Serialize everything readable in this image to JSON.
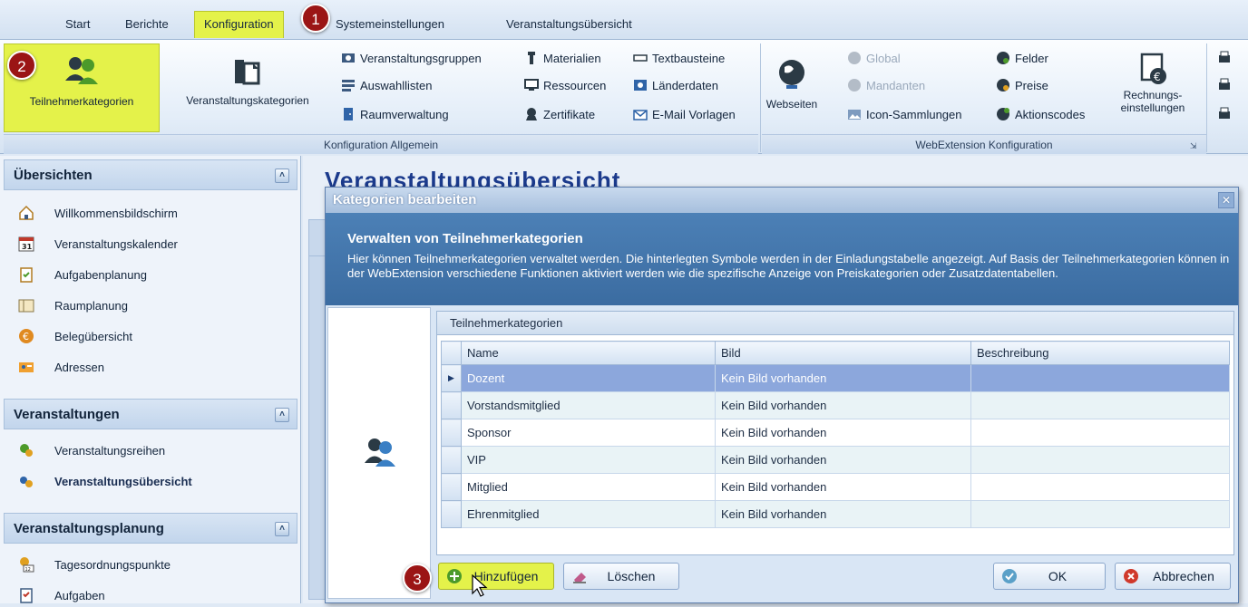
{
  "tabs": [
    {
      "label": "Start"
    },
    {
      "label": "Berichte"
    },
    {
      "label": "Konfiguration"
    },
    {
      "label": "Systemeinstellungen"
    },
    {
      "label": "Veranstaltungsübersicht"
    }
  ],
  "markers": [
    "1",
    "2",
    "3"
  ],
  "ribbon": {
    "teilnehmerkategorien": "Teilnehmerkategorien",
    "veranstaltungskategorien": "Veranstaltungskategorien",
    "veranstaltungsgruppen": "Veranstaltungsgruppen",
    "auswahllisten": "Auswahllisten",
    "raumverwaltung": "Raumverwaltung",
    "materialien": "Materialien",
    "ressourcen": "Ressourcen",
    "zertifikate": "Zertifikate",
    "textbausteine": "Textbausteine",
    "laenderdaten": "Länderdaten",
    "email_vorlagen": "E-Mail Vorlagen",
    "group_allgemein": "Konfiguration Allgemein",
    "webseiten": "Webseiten",
    "global": "Global",
    "mandanten": "Mandanten",
    "icon_sammlungen": "Icon-Sammlungen",
    "felder": "Felder",
    "preise": "Preise",
    "aktionscodes": "Aktionscodes",
    "rechnungs_line1": "Rechnungs-",
    "rechnungs_line2": "einstellungen",
    "group_web": "WebExtension Konfiguration"
  },
  "sidebar": {
    "uebersichten": "Übersichten",
    "items_uebersichten": [
      {
        "label": "Willkommensbildschirm"
      },
      {
        "label": "Veranstaltungskalender"
      },
      {
        "label": "Aufgabenplanung"
      },
      {
        "label": "Raumplanung"
      },
      {
        "label": "Belegübersicht"
      },
      {
        "label": "Adressen"
      }
    ],
    "veranstaltungen": "Veranstaltungen",
    "items_veranstaltungen": [
      {
        "label": "Veranstaltungsreihen"
      },
      {
        "label": "Veranstaltungsübersicht"
      }
    ],
    "veranstaltungsplanung": "Veranstaltungsplanung",
    "items_planung": [
      {
        "label": "Tagesordnungspunkte"
      },
      {
        "label": "Aufgaben"
      }
    ],
    "calendar_day": "31",
    "agenda_day": "12"
  },
  "background": {
    "title": "Veranstaltungsübersicht"
  },
  "dialog": {
    "title": "Kategorien bearbeiten",
    "header_title": "Verwalten von Teilnehmerkategorien",
    "header_text": "Hier können Teilnehmerkategorien verwaltet werden. Die hinterlegten Symbole werden in der Einladungstabelle angezeigt. Auf Basis der Teilnehmerkategorien können in der WebExtension verschiedene Funktionen aktiviert werden wie die spezifische Anzeige von Preiskategorien oder Zusatzdatentabellen.",
    "grid_caption": "Teilnehmerkategorien",
    "columns": {
      "name": "Name",
      "bild": "Bild",
      "beschreibung": "Beschreibung"
    },
    "rows": [
      {
        "name": "Dozent",
        "bild": "Kein Bild vorhanden",
        "beschreibung": ""
      },
      {
        "name": "Vorstandsmitglied",
        "bild": "Kein Bild vorhanden",
        "beschreibung": ""
      },
      {
        "name": "Sponsor",
        "bild": "Kein Bild vorhanden",
        "beschreibung": ""
      },
      {
        "name": "VIP",
        "bild": "Kein Bild vorhanden",
        "beschreibung": ""
      },
      {
        "name": "Mitglied",
        "bild": "Kein Bild vorhanden",
        "beschreibung": ""
      },
      {
        "name": "Ehrenmitglied",
        "bild": "Kein Bild vorhanden",
        "beschreibung": ""
      }
    ],
    "selected_row_name": "Dozent",
    "btn_add": "Hinzufügen",
    "btn_delete": "Löschen",
    "btn_ok": "OK",
    "btn_cancel": "Abbrechen"
  },
  "colors": {
    "highlight": "#e4f24a",
    "marker": "#9b1515",
    "dialog_header": "#3b6ca1",
    "selected_row": "#8ca7dc"
  }
}
